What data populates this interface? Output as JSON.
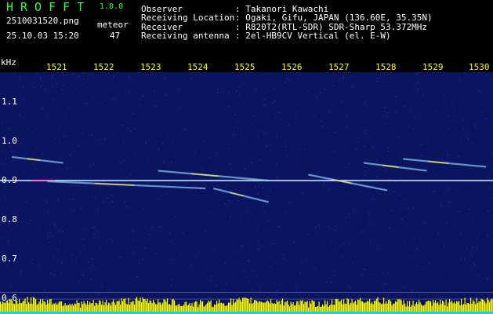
{
  "header": {
    "app_name": "HROFFT",
    "app_version": "1.0.0",
    "file_name": "2510031520.png",
    "timestamp": "25.10.03 15:20",
    "meteor_label": "meteor",
    "meteor_count": "47"
  },
  "info": [
    {
      "label": "Observer",
      "value": ": Takanori Kawachi"
    },
    {
      "label": "Receiving Location",
      "value": ": Ogaki, Gifu, JAPAN (136.60E, 35.35N)"
    },
    {
      "label": "Receiver",
      "value": ": R820T2(RTL-SDR) SDR-Sharp 53.372MHz"
    },
    {
      "label": "Receiving antenna",
      "value": ": 2el-HB9CV Vertical (el. E-W)"
    }
  ],
  "chart_data": {
    "type": "heatmap",
    "y_unit_label": "kHz",
    "x_ticks": [
      "1521",
      "1522",
      "1523",
      "1524",
      "1525",
      "1526",
      "1527",
      "1528",
      "1529",
      "1530"
    ],
    "y_ticks": [
      "1.1",
      "1.0",
      "0.9",
      "0.8",
      "0.7",
      "0.6"
    ],
    "y_range": [
      0.58,
      1.18
    ],
    "carrier_khz": 0.9,
    "meteor_echoes": [
      {
        "t_start": "1520:15",
        "t_end": "1521:20",
        "f_start_khz": 0.96,
        "f_end_khz": 0.945
      },
      {
        "t_start": "1523:20",
        "t_end": "1525:40",
        "f_start_khz": 0.925,
        "f_end_khz": 0.9
      },
      {
        "t_start": "1521:00",
        "t_end": "1524:20",
        "f_start_khz": 0.898,
        "f_end_khz": 0.88
      },
      {
        "t_start": "1524:30",
        "t_end": "1525:40",
        "f_start_khz": 0.88,
        "f_end_khz": 0.845
      },
      {
        "t_start": "1526:30",
        "t_end": "1528:10",
        "f_start_khz": 0.915,
        "f_end_khz": 0.875
      },
      {
        "t_start": "1527:40",
        "t_end": "1529:00",
        "f_start_khz": 0.945,
        "f_end_khz": 0.925
      },
      {
        "t_start": "1528:30",
        "t_end": "1530:15",
        "f_start_khz": 0.955,
        "f_end_khz": 0.935
      }
    ],
    "colors": {
      "background": "#0b1460",
      "carrier": "#ffffff",
      "echo": "#8fd8ff",
      "echo_core": "#ffe040",
      "bottom_bars": "#ffff00",
      "bottom_base": "#00d8ff"
    }
  }
}
